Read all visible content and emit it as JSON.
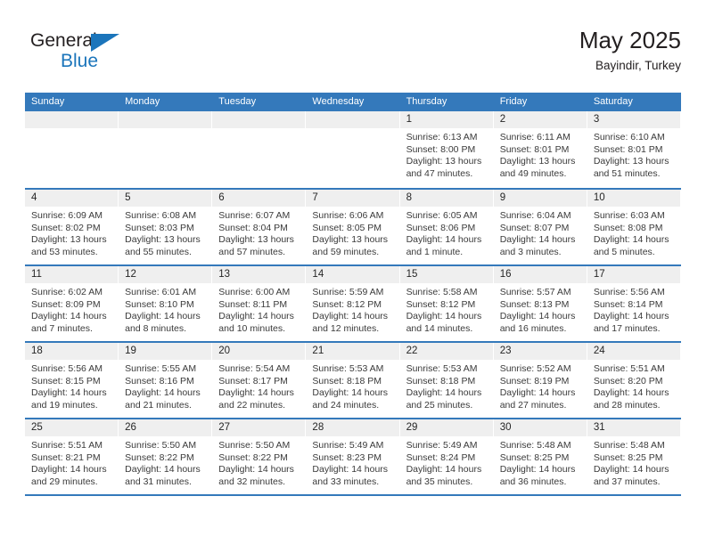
{
  "brand": {
    "name_part1": "General",
    "name_part2": "Blue",
    "accent_color": "#1b75bb",
    "triangle_icon": "triangle-icon"
  },
  "header": {
    "title": "May 2025",
    "subtitle": "Bayindir, Turkey"
  },
  "calendar": {
    "header_bg": "#3479bb",
    "weekdays": [
      "Sunday",
      "Monday",
      "Tuesday",
      "Wednesday",
      "Thursday",
      "Friday",
      "Saturday"
    ],
    "weeks": [
      [
        {
          "day": "",
          "sunrise": "",
          "sunset": "",
          "daylight": "",
          "empty": true
        },
        {
          "day": "",
          "sunrise": "",
          "sunset": "",
          "daylight": "",
          "empty": true
        },
        {
          "day": "",
          "sunrise": "",
          "sunset": "",
          "daylight": "",
          "empty": true
        },
        {
          "day": "",
          "sunrise": "",
          "sunset": "",
          "daylight": "",
          "empty": true
        },
        {
          "day": "1",
          "sunrise": "Sunrise: 6:13 AM",
          "sunset": "Sunset: 8:00 PM",
          "daylight": "Daylight: 13 hours and 47 minutes."
        },
        {
          "day": "2",
          "sunrise": "Sunrise: 6:11 AM",
          "sunset": "Sunset: 8:01 PM",
          "daylight": "Daylight: 13 hours and 49 minutes."
        },
        {
          "day": "3",
          "sunrise": "Sunrise: 6:10 AM",
          "sunset": "Sunset: 8:01 PM",
          "daylight": "Daylight: 13 hours and 51 minutes."
        }
      ],
      [
        {
          "day": "4",
          "sunrise": "Sunrise: 6:09 AM",
          "sunset": "Sunset: 8:02 PM",
          "daylight": "Daylight: 13 hours and 53 minutes."
        },
        {
          "day": "5",
          "sunrise": "Sunrise: 6:08 AM",
          "sunset": "Sunset: 8:03 PM",
          "daylight": "Daylight: 13 hours and 55 minutes."
        },
        {
          "day": "6",
          "sunrise": "Sunrise: 6:07 AM",
          "sunset": "Sunset: 8:04 PM",
          "daylight": "Daylight: 13 hours and 57 minutes."
        },
        {
          "day": "7",
          "sunrise": "Sunrise: 6:06 AM",
          "sunset": "Sunset: 8:05 PM",
          "daylight": "Daylight: 13 hours and 59 minutes."
        },
        {
          "day": "8",
          "sunrise": "Sunrise: 6:05 AM",
          "sunset": "Sunset: 8:06 PM",
          "daylight": "Daylight: 14 hours and 1 minute."
        },
        {
          "day": "9",
          "sunrise": "Sunrise: 6:04 AM",
          "sunset": "Sunset: 8:07 PM",
          "daylight": "Daylight: 14 hours and 3 minutes."
        },
        {
          "day": "10",
          "sunrise": "Sunrise: 6:03 AM",
          "sunset": "Sunset: 8:08 PM",
          "daylight": "Daylight: 14 hours and 5 minutes."
        }
      ],
      [
        {
          "day": "11",
          "sunrise": "Sunrise: 6:02 AM",
          "sunset": "Sunset: 8:09 PM",
          "daylight": "Daylight: 14 hours and 7 minutes."
        },
        {
          "day": "12",
          "sunrise": "Sunrise: 6:01 AM",
          "sunset": "Sunset: 8:10 PM",
          "daylight": "Daylight: 14 hours and 8 minutes."
        },
        {
          "day": "13",
          "sunrise": "Sunrise: 6:00 AM",
          "sunset": "Sunset: 8:11 PM",
          "daylight": "Daylight: 14 hours and 10 minutes."
        },
        {
          "day": "14",
          "sunrise": "Sunrise: 5:59 AM",
          "sunset": "Sunset: 8:12 PM",
          "daylight": "Daylight: 14 hours and 12 minutes."
        },
        {
          "day": "15",
          "sunrise": "Sunrise: 5:58 AM",
          "sunset": "Sunset: 8:12 PM",
          "daylight": "Daylight: 14 hours and 14 minutes."
        },
        {
          "day": "16",
          "sunrise": "Sunrise: 5:57 AM",
          "sunset": "Sunset: 8:13 PM",
          "daylight": "Daylight: 14 hours and 16 minutes."
        },
        {
          "day": "17",
          "sunrise": "Sunrise: 5:56 AM",
          "sunset": "Sunset: 8:14 PM",
          "daylight": "Daylight: 14 hours and 17 minutes."
        }
      ],
      [
        {
          "day": "18",
          "sunrise": "Sunrise: 5:56 AM",
          "sunset": "Sunset: 8:15 PM",
          "daylight": "Daylight: 14 hours and 19 minutes."
        },
        {
          "day": "19",
          "sunrise": "Sunrise: 5:55 AM",
          "sunset": "Sunset: 8:16 PM",
          "daylight": "Daylight: 14 hours and 21 minutes."
        },
        {
          "day": "20",
          "sunrise": "Sunrise: 5:54 AM",
          "sunset": "Sunset: 8:17 PM",
          "daylight": "Daylight: 14 hours and 22 minutes."
        },
        {
          "day": "21",
          "sunrise": "Sunrise: 5:53 AM",
          "sunset": "Sunset: 8:18 PM",
          "daylight": "Daylight: 14 hours and 24 minutes."
        },
        {
          "day": "22",
          "sunrise": "Sunrise: 5:53 AM",
          "sunset": "Sunset: 8:18 PM",
          "daylight": "Daylight: 14 hours and 25 minutes."
        },
        {
          "day": "23",
          "sunrise": "Sunrise: 5:52 AM",
          "sunset": "Sunset: 8:19 PM",
          "daylight": "Daylight: 14 hours and 27 minutes."
        },
        {
          "day": "24",
          "sunrise": "Sunrise: 5:51 AM",
          "sunset": "Sunset: 8:20 PM",
          "daylight": "Daylight: 14 hours and 28 minutes."
        }
      ],
      [
        {
          "day": "25",
          "sunrise": "Sunrise: 5:51 AM",
          "sunset": "Sunset: 8:21 PM",
          "daylight": "Daylight: 14 hours and 29 minutes."
        },
        {
          "day": "26",
          "sunrise": "Sunrise: 5:50 AM",
          "sunset": "Sunset: 8:22 PM",
          "daylight": "Daylight: 14 hours and 31 minutes."
        },
        {
          "day": "27",
          "sunrise": "Sunrise: 5:50 AM",
          "sunset": "Sunset: 8:22 PM",
          "daylight": "Daylight: 14 hours and 32 minutes."
        },
        {
          "day": "28",
          "sunrise": "Sunrise: 5:49 AM",
          "sunset": "Sunset: 8:23 PM",
          "daylight": "Daylight: 14 hours and 33 minutes."
        },
        {
          "day": "29",
          "sunrise": "Sunrise: 5:49 AM",
          "sunset": "Sunset: 8:24 PM",
          "daylight": "Daylight: 14 hours and 35 minutes."
        },
        {
          "day": "30",
          "sunrise": "Sunrise: 5:48 AM",
          "sunset": "Sunset: 8:25 PM",
          "daylight": "Daylight: 14 hours and 36 minutes."
        },
        {
          "day": "31",
          "sunrise": "Sunrise: 5:48 AM",
          "sunset": "Sunset: 8:25 PM",
          "daylight": "Daylight: 14 hours and 37 minutes."
        }
      ]
    ]
  }
}
